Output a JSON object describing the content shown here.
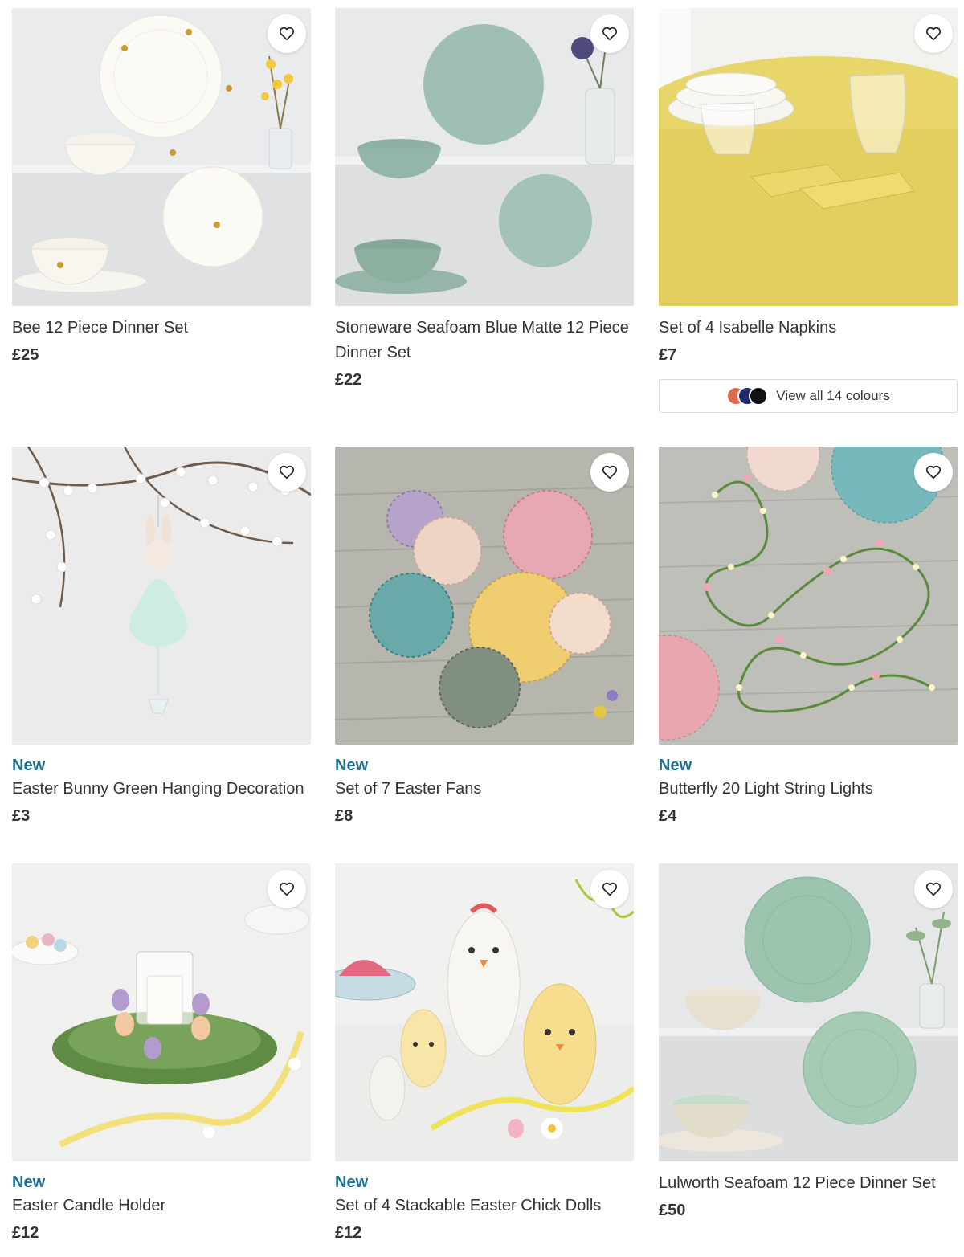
{
  "products": [
    {
      "title": "Bee 12 Piece Dinner Set",
      "price": "£25",
      "badge": ""
    },
    {
      "title": "Stoneware Seafoam Blue Matte 12 Piece Dinner Set",
      "price": "£22",
      "badge": ""
    },
    {
      "title": "Set of 4 Isabelle Napkins",
      "price": "£7",
      "badge": "",
      "swatches": {
        "label": "View all 14 colours",
        "colors": [
          "#e06a4e",
          "#1d2a6b",
          "#111111"
        ]
      }
    },
    {
      "title": "Easter Bunny Green Hanging Decoration",
      "price": "£3",
      "badge": "New"
    },
    {
      "title": "Set of 7 Easter Fans",
      "price": "£8",
      "badge": "New"
    },
    {
      "title": "Butterfly 20 Light String Lights",
      "price": "£4",
      "badge": "New"
    },
    {
      "title": "Easter Candle Holder",
      "price": "£12",
      "badge": "New"
    },
    {
      "title": "Set of 4 Stackable Easter Chick Dolls",
      "price": "£12",
      "badge": "New"
    },
    {
      "title": "Lulworth Seafoam 12 Piece Dinner Set",
      "price": "£50",
      "badge": ""
    }
  ],
  "wishlist_icon": "heart-icon",
  "colors": {
    "badge": "#1f6e8c",
    "text": "#333333"
  }
}
